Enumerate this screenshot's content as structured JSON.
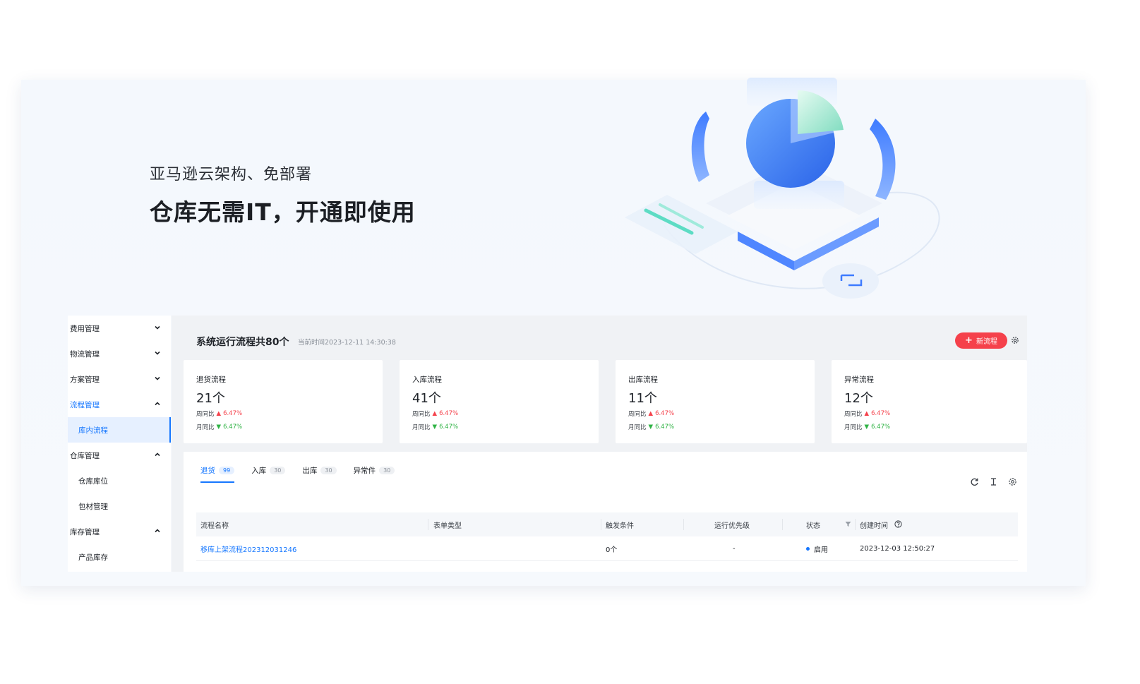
{
  "hero": {
    "subtitle": "亚马逊云架构、免部署",
    "title": "仓库无需IT，开通即使用"
  },
  "sidebar": {
    "items": [
      {
        "label": "费用管理",
        "expanded": false
      },
      {
        "label": "物流管理",
        "expanded": false
      },
      {
        "label": "方案管理",
        "expanded": false
      },
      {
        "label": "流程管理",
        "expanded": true,
        "active": true
      },
      {
        "label": "库内流程",
        "sub": true,
        "selected": true
      },
      {
        "label": "仓库管理",
        "expanded": true
      },
      {
        "label": "仓库库位",
        "sub": true
      },
      {
        "label": "包材管理",
        "sub": true
      },
      {
        "label": "库存管理",
        "expanded": true
      },
      {
        "label": "产品库存",
        "sub": true
      }
    ]
  },
  "header": {
    "title": "系统运行流程共80个",
    "time": "当前时间2023-12-11 14:30:38",
    "new_button": "新流程"
  },
  "stats": [
    {
      "label": "退货流程",
      "value": "21个",
      "week_label": "周同比",
      "week": "6.47%",
      "month_label": "月同比",
      "month": "6.47%"
    },
    {
      "label": "入库流程",
      "value": "41个",
      "week_label": "周同比",
      "week": "6.47%",
      "month_label": "月同比",
      "month": "6.47%"
    },
    {
      "label": "出库流程",
      "value": "11个",
      "week_label": "周同比",
      "week": "6.47%",
      "month_label": "月同比",
      "month": "6.47%"
    },
    {
      "label": "异常流程",
      "value": "12个",
      "week_label": "周同比",
      "week": "6.47%",
      "month_label": "月同比",
      "month": "6.47%"
    }
  ],
  "tabs": [
    {
      "label": "退货",
      "count": "99",
      "active": true
    },
    {
      "label": "入库",
      "count": "30"
    },
    {
      "label": "出库",
      "count": "30"
    },
    {
      "label": "异常件",
      "count": "30"
    }
  ],
  "table": {
    "columns": [
      "流程名称",
      "表单类型",
      "触发条件",
      "运行优先级",
      "状态",
      "创建时间"
    ],
    "rows": [
      {
        "name": "移库上架流程202312031246",
        "form": "",
        "trigger": "0个",
        "priority": "-",
        "status": "启用",
        "created": "2023-12-03 12:50:27"
      }
    ]
  },
  "colors": {
    "primary": "#1677ff",
    "danger": "#f5414b",
    "success": "#2fb344"
  }
}
